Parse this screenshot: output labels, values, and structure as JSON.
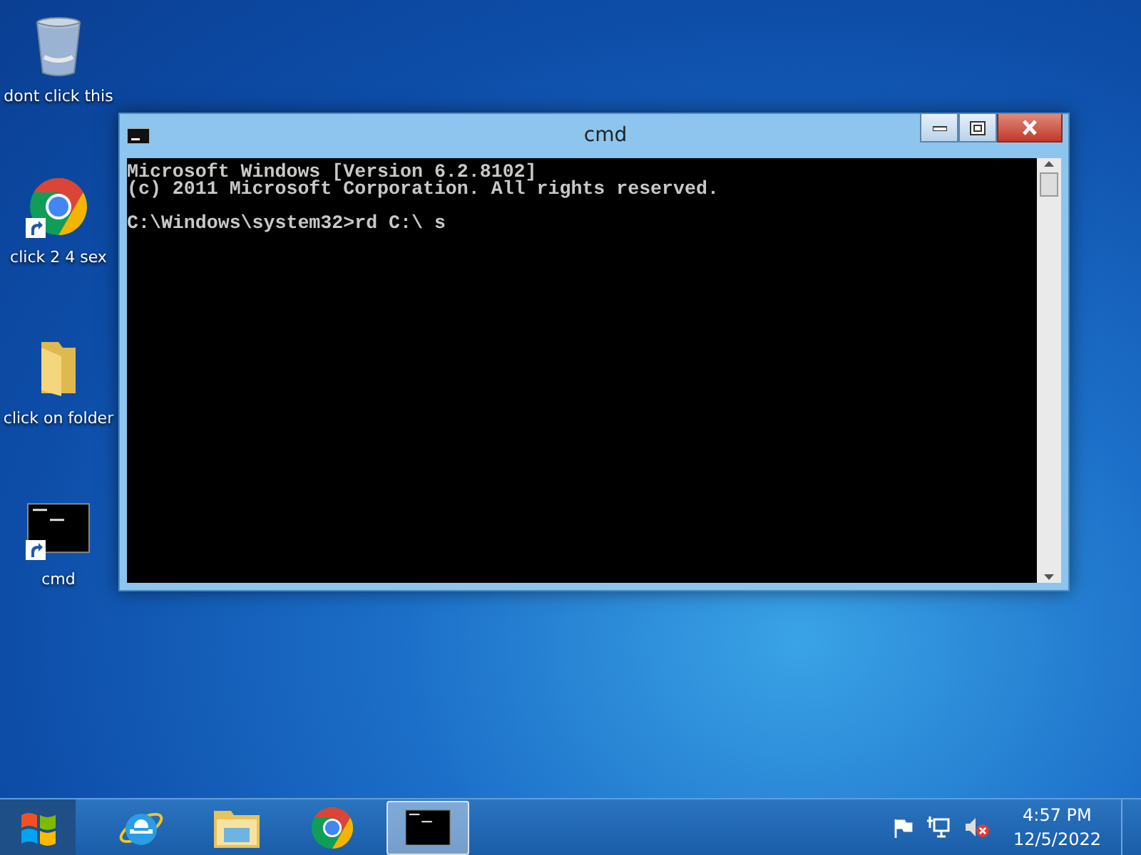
{
  "desktop_icons": [
    {
      "label": "dont click this",
      "kind": "recycle",
      "shortcut": false
    },
    {
      "label": "click 2 4 sex",
      "kind": "chrome",
      "shortcut": true
    },
    {
      "label": "click on folder",
      "kind": "folder",
      "shortcut": false
    },
    {
      "label": "cmd",
      "kind": "console",
      "shortcut": true
    }
  ],
  "window": {
    "title": "cmd",
    "banner": [
      "Microsoft Windows [Version 6.2.8102]",
      "(c) 2011 Microsoft Corporation. All rights reserved."
    ],
    "prompt": "C:\\Windows\\system32>rd C:\\ s"
  },
  "taskbar": {
    "items": [
      {
        "kind": "ie",
        "selected": false
      },
      {
        "kind": "explorer",
        "selected": false
      },
      {
        "kind": "chrome",
        "selected": false
      },
      {
        "kind": "console",
        "selected": true
      }
    ],
    "clock": {
      "time": "4:57 PM",
      "date": "12/5/2022"
    }
  }
}
